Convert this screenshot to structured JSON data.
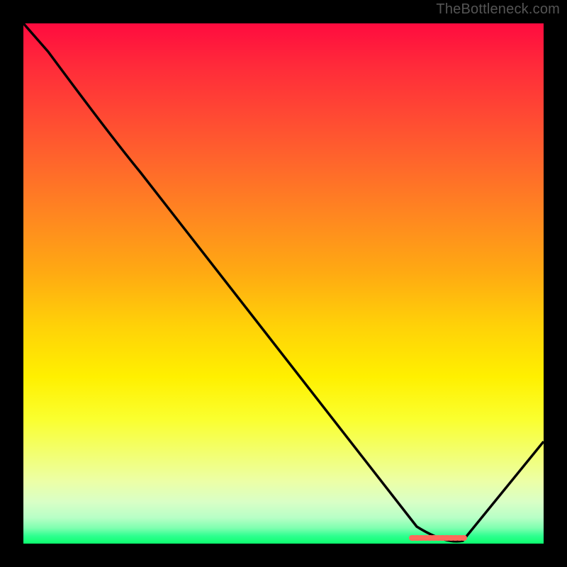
{
  "watermark": "TheBottleneck.com",
  "chart_data": {
    "type": "line",
    "title": "",
    "xlabel": "",
    "ylabel": "",
    "xlim": [
      0,
      100
    ],
    "ylim": [
      0,
      100
    ],
    "x": [
      0,
      20,
      75,
      84,
      100
    ],
    "values": [
      100,
      78,
      3,
      0,
      20
    ],
    "gradient_stops": [
      {
        "pos": 0,
        "color": "#ff0b3f"
      },
      {
        "pos": 0.18,
        "color": "#ff4a33"
      },
      {
        "pos": 0.38,
        "color": "#ff8a1f"
      },
      {
        "pos": 0.58,
        "color": "#ffd108"
      },
      {
        "pos": 0.76,
        "color": "#faff2e"
      },
      {
        "pos": 0.92,
        "color": "#d9ffc6"
      },
      {
        "pos": 1.0,
        "color": "#0cff6e"
      }
    ],
    "marker": {
      "x_start": 75,
      "x_end": 84,
      "color": "#ff6666"
    }
  }
}
